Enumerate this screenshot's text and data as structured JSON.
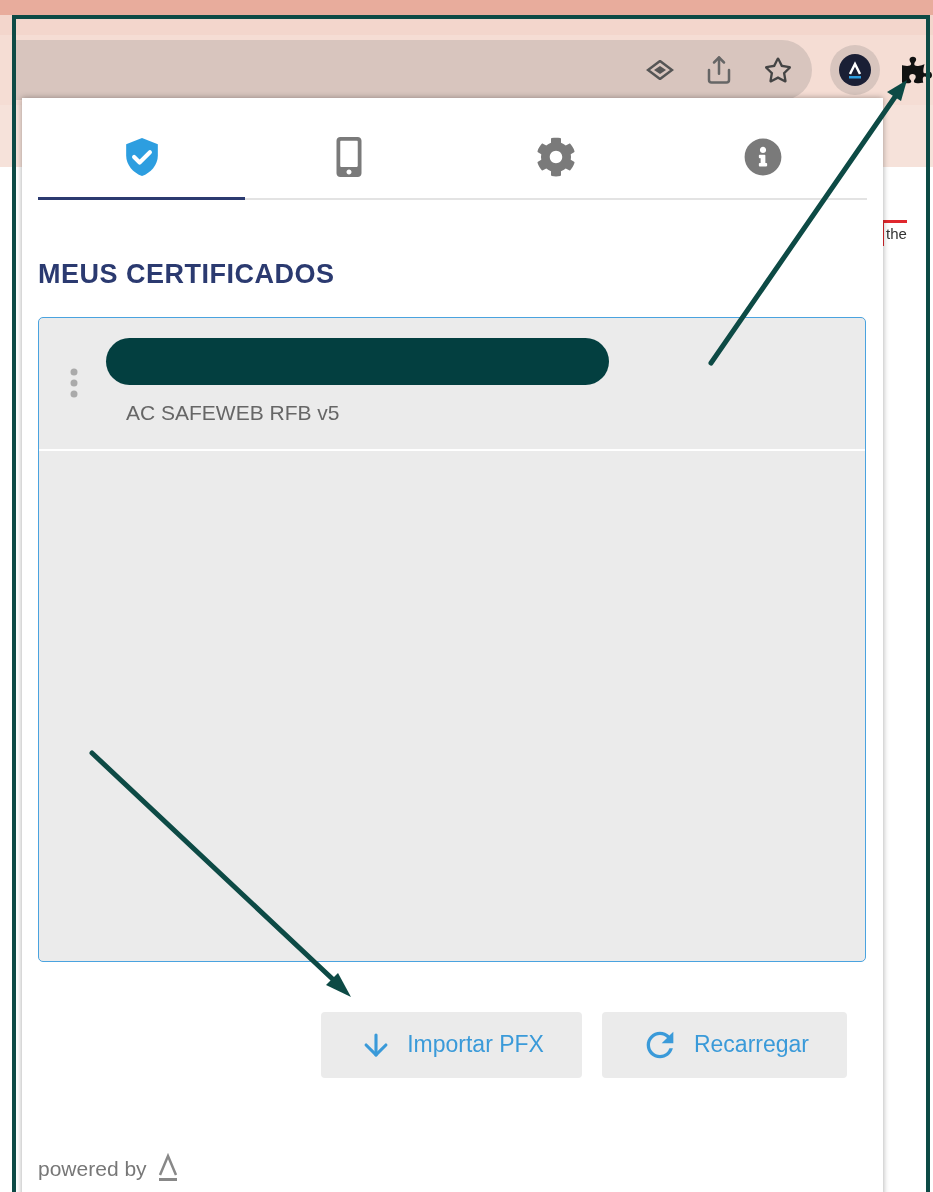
{
  "page_fragment": {
    "logo_text": "the"
  },
  "popup": {
    "tabs": [
      {
        "kind": "certificates",
        "selected": true
      },
      {
        "kind": "device",
        "selected": false
      },
      {
        "kind": "settings",
        "selected": false
      },
      {
        "kind": "info",
        "selected": false
      }
    ],
    "title": "MEUS CERTIFICADOS",
    "certificates": [
      {
        "issuer": "AC SAFEWEB RFB v5",
        "name_redacted": true
      }
    ],
    "buttons": [
      {
        "kind": "import",
        "label": "Importar PFX"
      },
      {
        "kind": "reload",
        "label": "Recarregar"
      }
    ],
    "footer": "powered by"
  }
}
